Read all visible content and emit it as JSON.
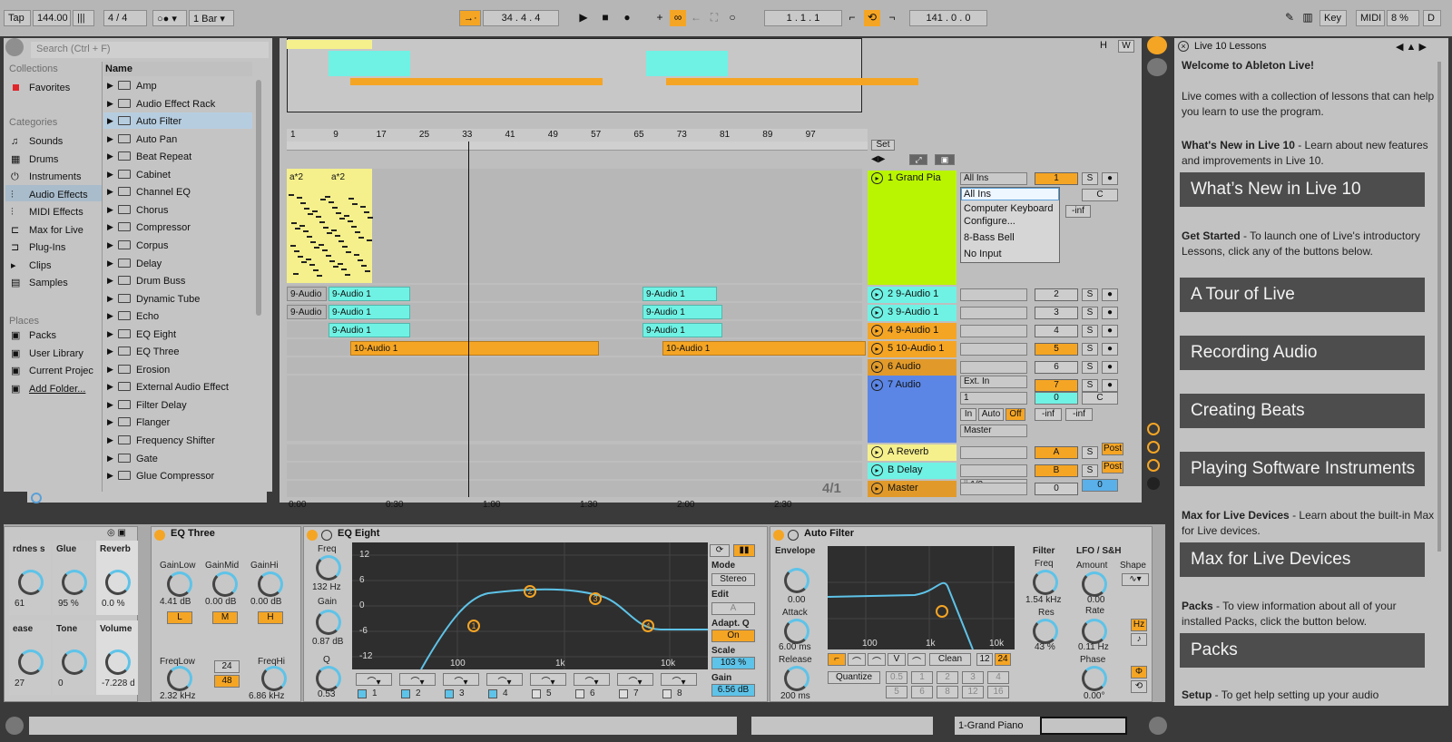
{
  "topbar": {
    "tap": "Tap",
    "tempo": "144.00",
    "sig": "4 / 4",
    "quant": "1 Bar",
    "pos": "34 .  4 .  4",
    "loopstart": "1 .  1 .  1",
    "looplen": "141 .  0 .  0",
    "key": "Key",
    "midi": "MIDI",
    "cpu": "8 %",
    "d": "D"
  },
  "browser": {
    "search": "Search (Ctrl + F)",
    "collections_label": "Collections",
    "favorites": "Favorites",
    "categories_label": "Categories",
    "categories": [
      "Sounds",
      "Drums",
      "Instruments",
      "Audio Effects",
      "MIDI Effects",
      "Max for Live",
      "Plug-Ins",
      "Clips",
      "Samples"
    ],
    "places_label": "Places",
    "places": [
      "Packs",
      "User Library",
      "Current Projec",
      "Add Folder..."
    ],
    "name_header": "Name",
    "items": [
      "Amp",
      "Audio Effect Rack",
      "Auto Filter",
      "Auto Pan",
      "Beat Repeat",
      "Cabinet",
      "Channel EQ",
      "Chorus",
      "Compressor",
      "Corpus",
      "Delay",
      "Drum Buss",
      "Dynamic Tube",
      "Echo",
      "EQ Eight",
      "EQ Three",
      "Erosion",
      "External Audio Effect",
      "Filter Delay",
      "Flanger",
      "Frequency Shifter",
      "Gate",
      "Glue Compressor"
    ]
  },
  "arrange": {
    "ruler": [
      "1",
      "9",
      "17",
      "25",
      "33",
      "41",
      "49",
      "57",
      "65",
      "73",
      "81",
      "89",
      "97"
    ],
    "time": [
      "0:00",
      "0:30",
      "1:00",
      "1:30",
      "2:00",
      "2:30"
    ],
    "set": "Set",
    "meter": "4/1",
    "hw": [
      "H",
      "W"
    ],
    "clips_midi": [
      "a*2",
      "a*2"
    ],
    "tracks": [
      {
        "name": "1 Grand Pia",
        "num": "1"
      },
      {
        "name": "2 9-Audio 1",
        "num": "2"
      },
      {
        "name": "3 9-Audio 1",
        "num": "3"
      },
      {
        "name": "4 9-Audio 1",
        "num": "4"
      },
      {
        "name": "5 10-Audio 1",
        "num": "5"
      },
      {
        "name": "6 Audio",
        "num": "6"
      },
      {
        "name": "7 Audio",
        "num": "7"
      },
      {
        "name": "A Reverb",
        "num": "A"
      },
      {
        "name": "B Delay",
        "num": "B"
      },
      {
        "name": "Master",
        "num": "0"
      }
    ],
    "clip_labels": {
      "c9a": "9-Audio",
      "c91": "9-Audio 1",
      "c10": "10-Audio 1"
    },
    "io": {
      "allins": "All Ins",
      "extin": "Ext. In",
      "ch1": "1",
      "in": "In",
      "auto": "Auto",
      "off": "Off",
      "master": "Master",
      "half": "ii 1/2",
      "zero": "0",
      "c": "C",
      "inf": "-inf",
      "post": "Post",
      "s": "S"
    },
    "menu": [
      "All Ins",
      "Computer Keyboard",
      "Configure...",
      "8-Bass Bell",
      "No Input"
    ]
  },
  "lessons": {
    "title": "Live 10 Lessons",
    "welcome": "Welcome to Ableton Live!",
    "intro": "Live comes with a collection of lessons that can help you learn to use the program.",
    "whatsnew_b": "What's New in Live 10",
    "whatsnew_t": " - Learn about new features and improvements in Live 10.",
    "btn1": "What’s New in Live 10",
    "started_b": "Get Started",
    "started_t": " - To launch one of Live's introductory Lessons, click any of the buttons below.",
    "btn2": "A Tour of Live",
    "btn3": "Recording Audio",
    "btn4": "Creating Beats",
    "btn5": "Playing Software Instruments",
    "m4l_b": "Max for Live Devices",
    "m4l_t": " - Learn about the built-in Max for Live devices.",
    "btn6": "Max for Live Devices",
    "packs_b": "Packs",
    "packs_t": " - To view information about all of your installed Packs, click the button below.",
    "btn7": "Packs",
    "setup_b": "Setup",
    "setup_t": " - To get help setting up your audio"
  },
  "devices": {
    "glue": {
      "labels": [
        "rdnes s",
        "Glue",
        "Reverb",
        "ease",
        "Tone",
        "Volume"
      ],
      "values": [
        "61",
        "95 %",
        "0.0 %",
        "27",
        "0",
        "-7.228 d"
      ]
    },
    "eq3": {
      "title": "EQ Three",
      "labels": [
        "GainLow",
        "GainMid",
        "GainHi",
        "FreqLow",
        "FreqHi"
      ],
      "values": [
        "4.41 dB",
        "0.00 dB",
        "0.00 dB",
        "2.32 kHz",
        "6.86 kHz"
      ],
      "lmh": [
        "L",
        "M",
        "H"
      ],
      "slope": [
        "24",
        "48"
      ]
    },
    "eq8": {
      "title": "EQ Eight",
      "freq": "Freq",
      "freqv": "132 Hz",
      "gain": "Gain",
      "gainv": "0.87 dB",
      "q": "Q",
      "qv": "0.53",
      "ylabels": [
        "12",
        "6",
        "0",
        "-6",
        "-12"
      ],
      "xlabels": [
        "100",
        "1k",
        "10k"
      ],
      "mode": "Mode",
      "modev": "Stereo",
      "edit": "Edit",
      "editv": "A",
      "adapt": "Adapt. Q",
      "on": "On",
      "scale": "Scale",
      "scalev": "103 %",
      "gain2": "Gain",
      "gain2v": "6.56 dB",
      "bands": [
        "1",
        "2",
        "3",
        "4",
        "5",
        "6",
        "7",
        "8"
      ]
    },
    "af": {
      "title": "Auto Filter",
      "envelope": "Envelope",
      "envv": "0.00",
      "attack": "Attack",
      "attackv": "6.00 ms",
      "release": "Release",
      "releasev": "200 ms",
      "filter": "Filter",
      "freq": "Freq",
      "freqv": "1.54 kHz",
      "res": "Res",
      "resv": "43 %",
      "lfo": "LFO / S&H",
      "amount": "Amount",
      "amountv": "0.00",
      "shape": "Shape",
      "rate": "Rate",
      "ratev": "0.11 Hz",
      "phase": "Phase",
      "phasev": "0.00°",
      "hz": "Hz",
      "clean": "Clean",
      "n12": "12",
      "n24": "24",
      "quantize": "Quantize",
      "qv": [
        "0.5",
        "1",
        "2",
        "3",
        "4",
        "5",
        "6",
        "8",
        "12",
        "16"
      ],
      "xlabels": [
        "100",
        "1k",
        "10k"
      ]
    }
  },
  "status": {
    "track": "1-Grand Piano"
  }
}
